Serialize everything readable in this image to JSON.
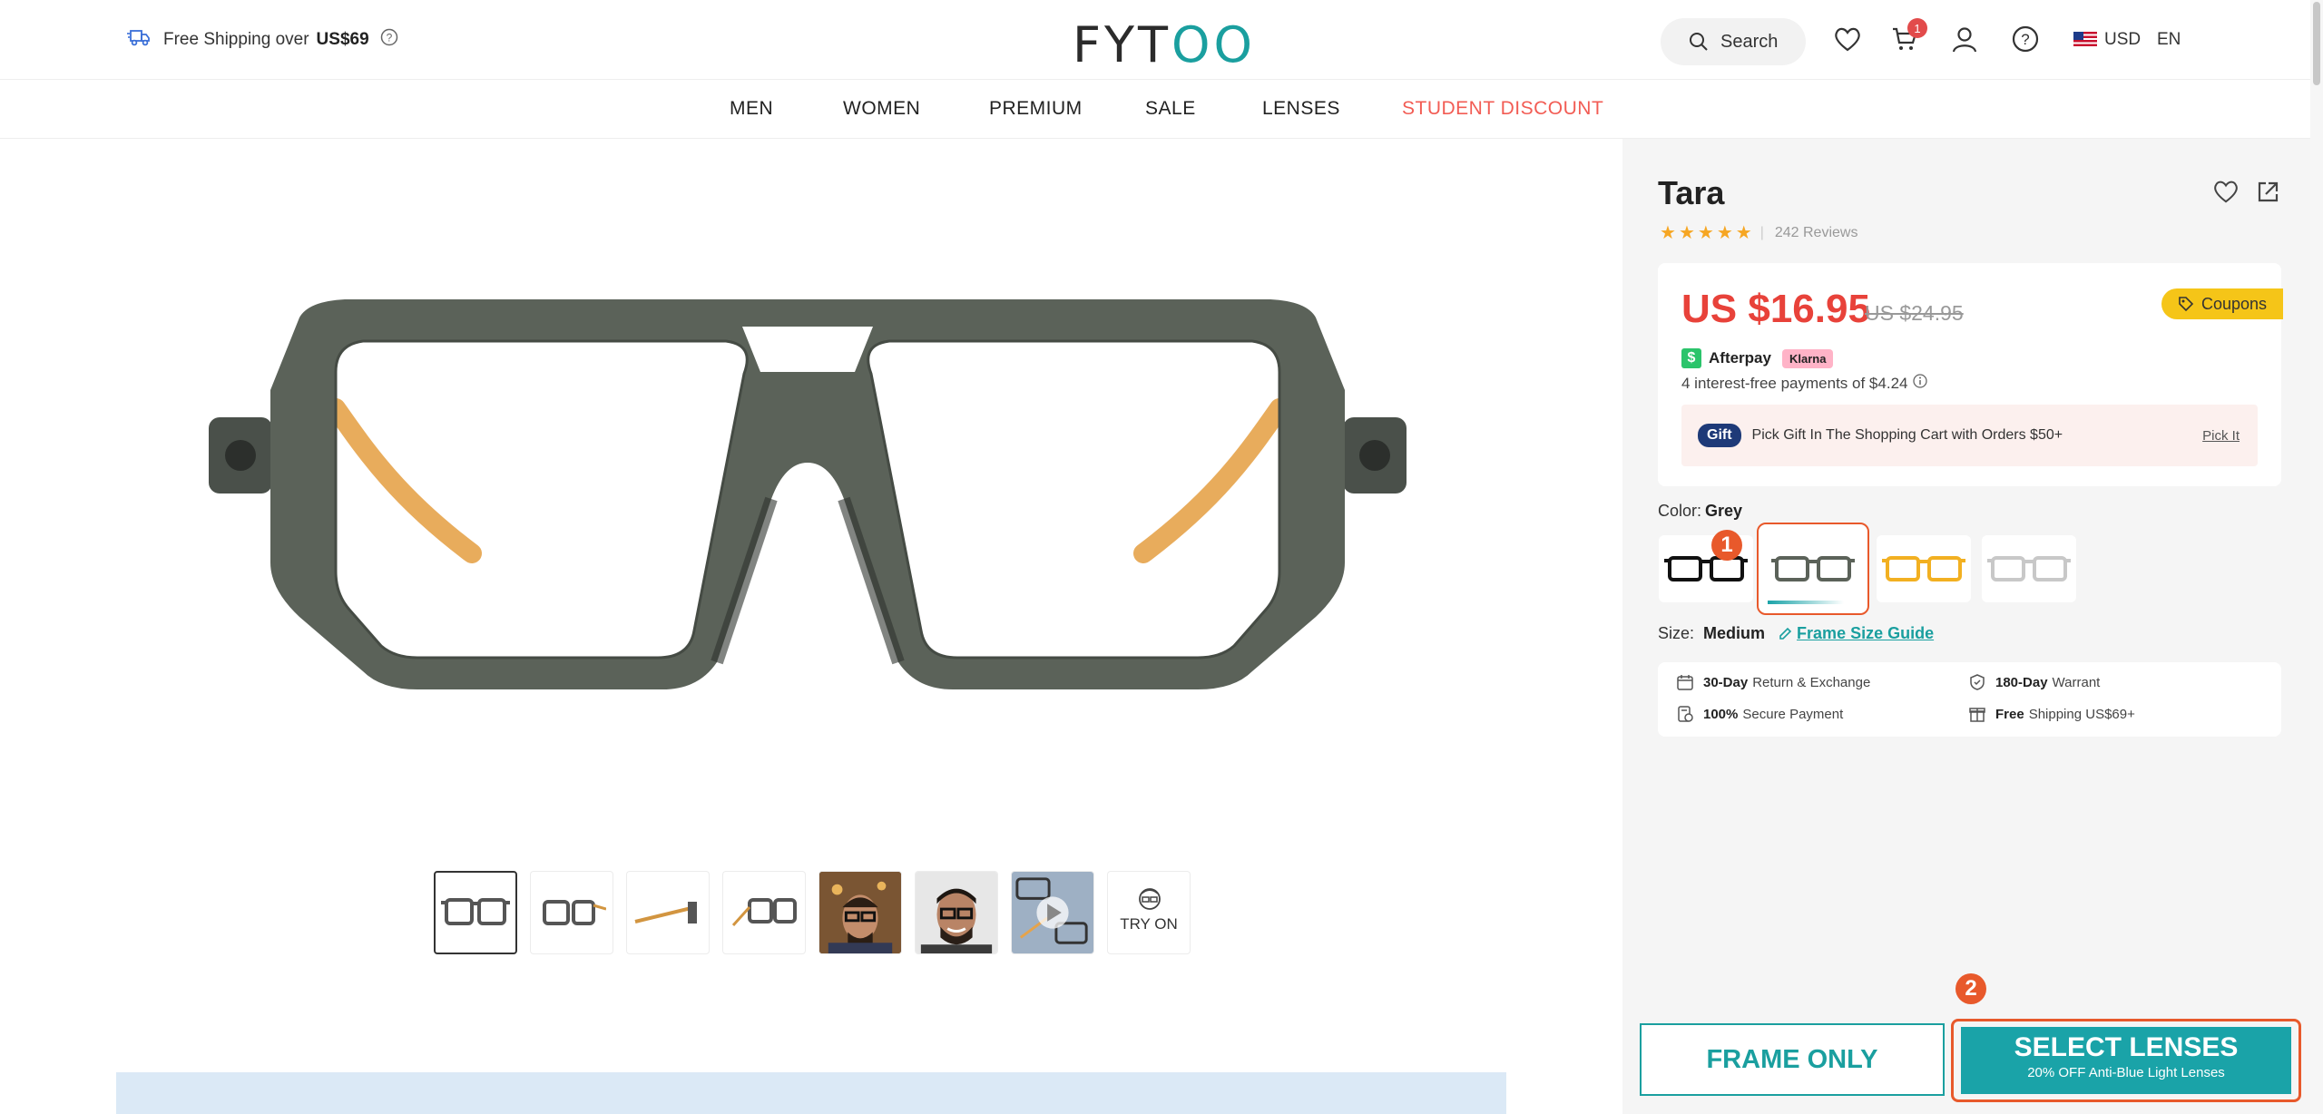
{
  "header": {
    "shipping_prefix": "Free Shipping over",
    "shipping_amount": "US$69",
    "logo_left": "FYT",
    "logo_right": "OO",
    "search_label": "Search",
    "cart_count": "1",
    "currency": "USD",
    "language": "EN"
  },
  "nav": {
    "items": [
      "MEN",
      "WOMEN",
      "PREMIUM",
      "SALE",
      "LENSES",
      "STUDENT DISCOUNT"
    ]
  },
  "gallery": {
    "try_on_label": "TRY ON"
  },
  "product": {
    "name": "Tara",
    "reviews": "242 Reviews",
    "price": "US $16.95",
    "old_price": "US $24.95",
    "coupons_label": "Coupons",
    "afterpay_label": "Afterpay",
    "klarna_label": "Klarna",
    "installments": "4 interest-free payments of $4.24",
    "gift_badge": "Gift",
    "gift_text": "Pick Gift In The Shopping Cart with Orders $50+",
    "gift_link": "Pick It",
    "color_label": "Color:",
    "color_value": "Grey",
    "size_label": "Size:",
    "size_value": "Medium",
    "size_guide": "Frame Size Guide"
  },
  "benefits": {
    "b1_bold": "30-Day",
    "b1_text": "Return & Exchange",
    "b2_bold": "180-Day",
    "b2_text": "Warrant",
    "b3_bold": "100%",
    "b3_text": "Secure Payment",
    "b4_bold": "Free",
    "b4_text": "Shipping US$69+"
  },
  "actions": {
    "frame_only": "FRAME ONLY",
    "select_lenses": "SELECT LENSES",
    "select_lenses_sub": "20% OFF Anti-Blue Light Lenses"
  },
  "markers": {
    "m1": "1",
    "m2": "2"
  },
  "colors": {
    "brand_teal": "#1a9f9f",
    "price_red": "#e8423a",
    "highlight_orange": "#e8592b",
    "frame_grey": "#5b6259",
    "temple_amber": "#e6a34a"
  }
}
